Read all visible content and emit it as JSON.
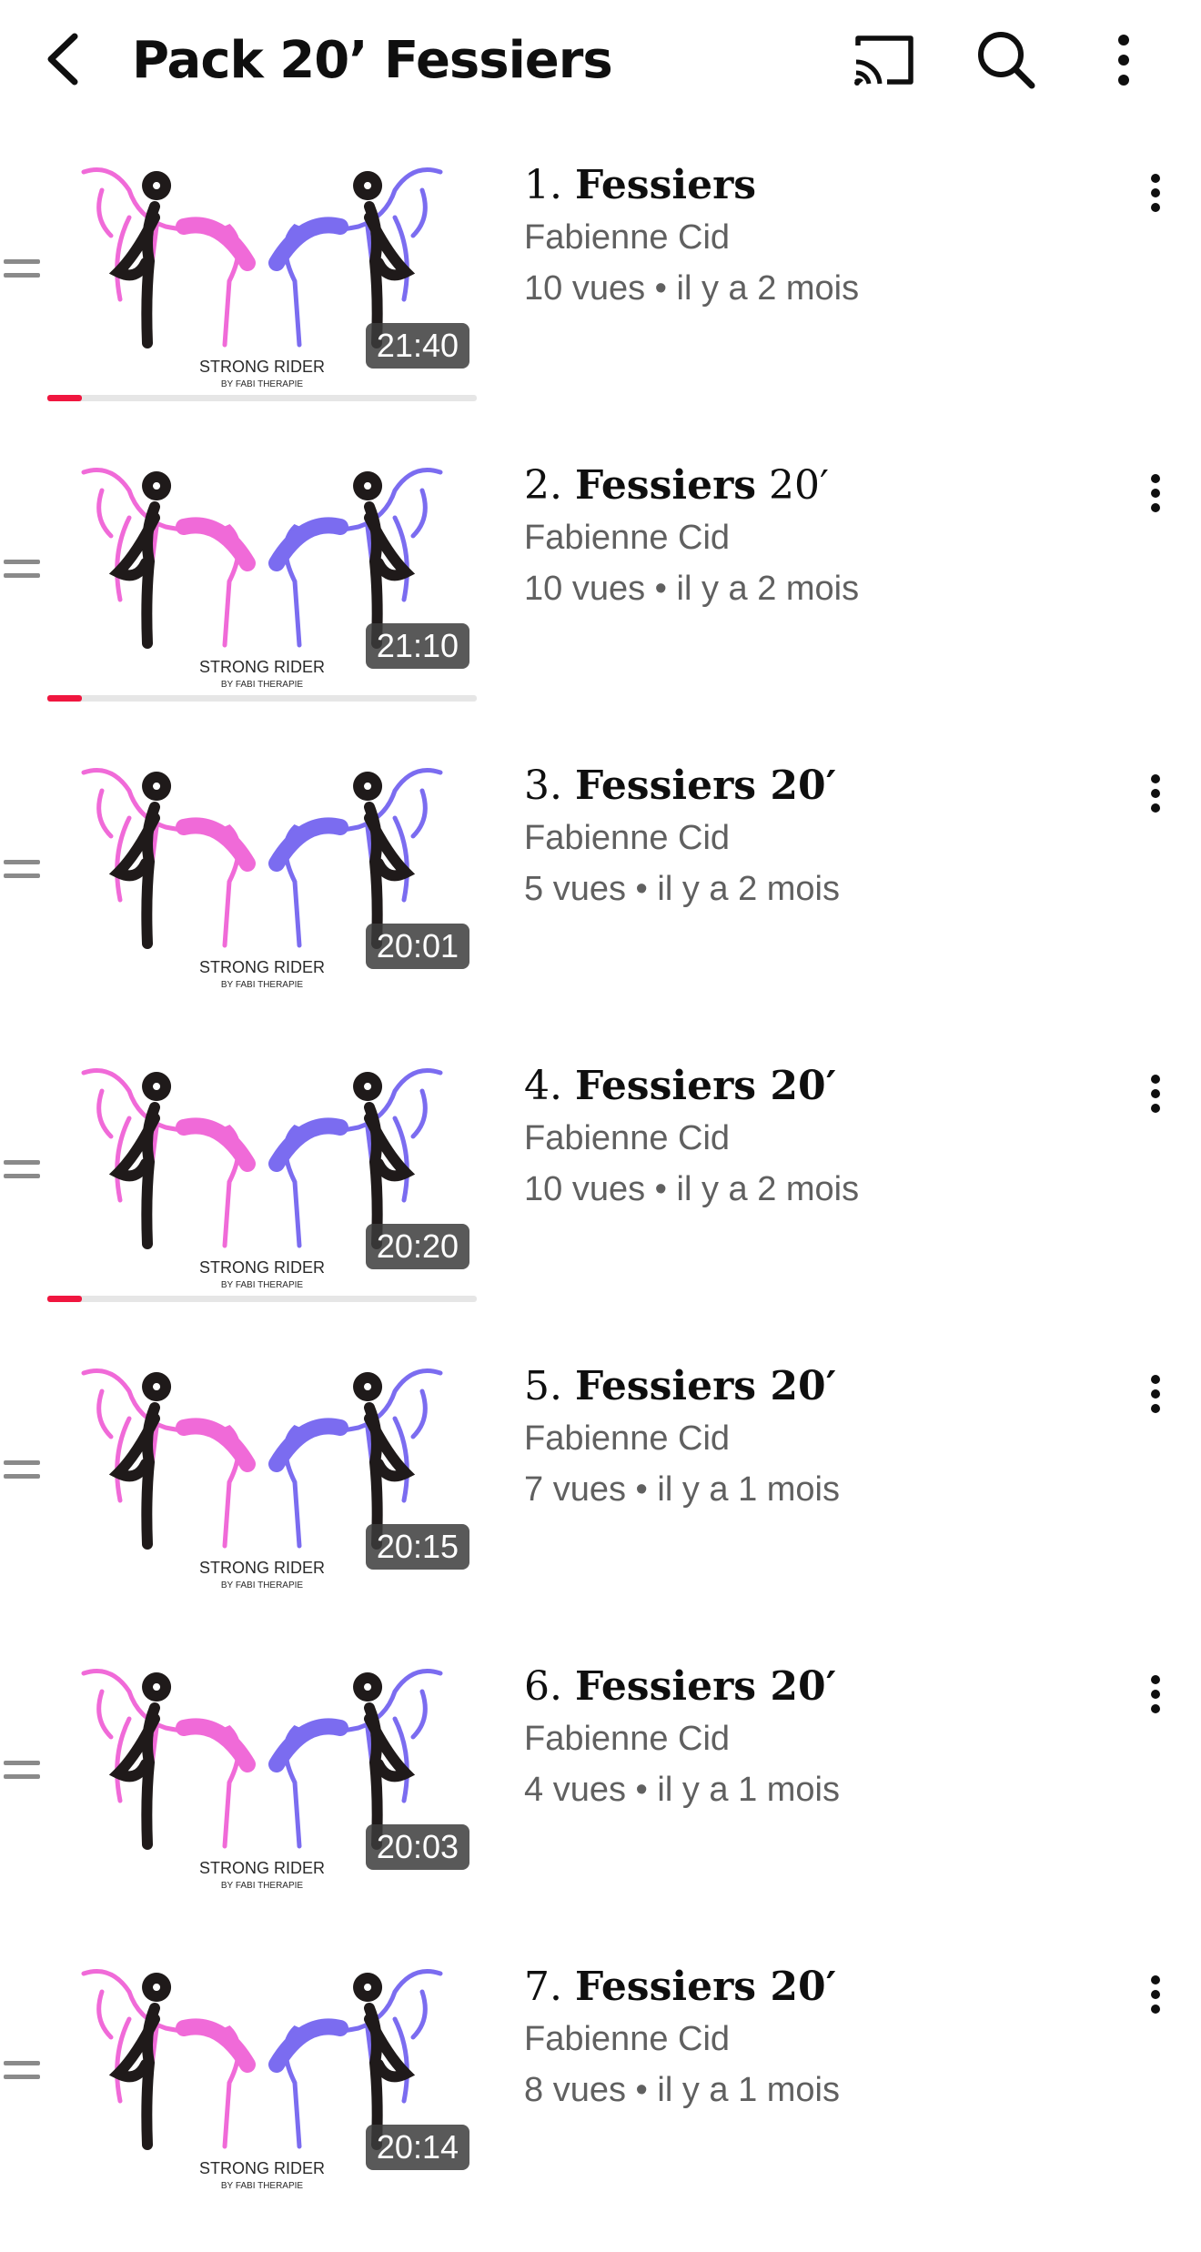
{
  "header": {
    "title": "Pack 20’ Fessiers",
    "icons": [
      "back-arrow-icon",
      "cast-icon",
      "search-icon",
      "more-vert-icon"
    ]
  },
  "thumbnail": {
    "brand": "STRONG RIDER",
    "tagline": "BY FABI THERAPIE",
    "colors": {
      "pink": "#f06ad8",
      "purple": "#7b6cf0",
      "silhouette": "#1f1a1a"
    }
  },
  "videos": [
    {
      "num": "1.",
      "name": "Fessiers",
      "suffix": "",
      "channel": "Fabienne Cid",
      "views": "10 vues",
      "age": "il y a 2 mois",
      "duration": "21:40",
      "progress": 0.08
    },
    {
      "num": "2.",
      "name": "Fessiers",
      "suffix": " 20′",
      "channel": "Fabienne Cid",
      "views": "10 vues",
      "age": "il y a 2 mois",
      "duration": "21:10",
      "progress": 0.08
    },
    {
      "num": "3.",
      "name": "Fessiers 20′",
      "suffix": "",
      "channel": "Fabienne Cid",
      "views": "5 vues",
      "age": "il y a 2 mois",
      "duration": "20:01",
      "progress": 0
    },
    {
      "num": "4.",
      "name": "Fessiers 20′",
      "suffix": "",
      "channel": "Fabienne Cid",
      "views": "10 vues",
      "age": "il y a 2 mois",
      "duration": "20:20",
      "progress": 0.08
    },
    {
      "num": "5.",
      "name": "Fessiers 20′",
      "suffix": "",
      "channel": "Fabienne Cid",
      "views": "7 vues",
      "age": "il y a 1 mois",
      "duration": "20:15",
      "progress": 0
    },
    {
      "num": "6.",
      "name": "Fessiers 20′",
      "suffix": "",
      "channel": "Fabienne Cid",
      "views": "4 vues",
      "age": "il y a 1 mois",
      "duration": "20:03",
      "progress": 0
    },
    {
      "num": "7.",
      "name": "Fessiers 20′",
      "suffix": "",
      "channel": "Fabienne Cid",
      "views": "8 vues",
      "age": "il y a 1 mois",
      "duration": "20:14",
      "progress": 0
    }
  ]
}
